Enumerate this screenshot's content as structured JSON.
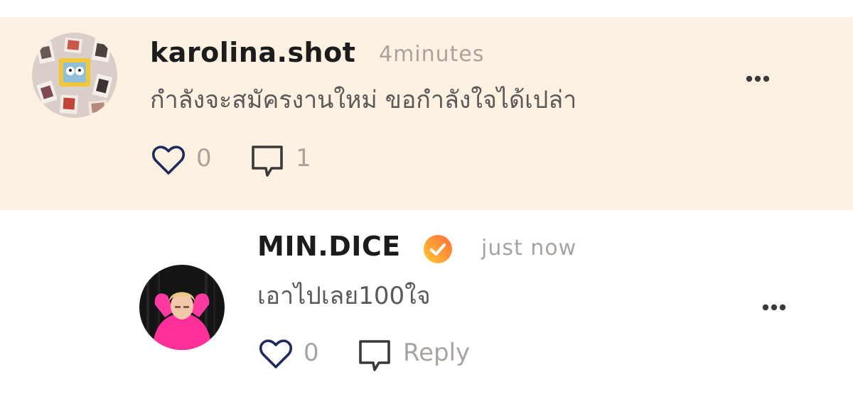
{
  "comment": {
    "username": "karolina.shot",
    "timestamp": "4minutes",
    "text": "กำลังจะสมัครงานใหม่ ขอกำลังใจได้เปล่า",
    "like_count": "0",
    "reply_count": "1",
    "avatar_icon": "photo-collage-avatar",
    "highlight_color": "#fdf1e2"
  },
  "reply": {
    "username": "MIN.DICE",
    "verified_icon": "verified-badge-icon",
    "timestamp": "just now",
    "text": "เอาไปเลย100ใจ",
    "like_count": "0",
    "reply_label": "Reply",
    "avatar_icon": "person-pink-hoodie-avatar"
  },
  "colors": {
    "accent_heart": "#1f2a5c",
    "badge_gradient_start": "#ffcc33",
    "badge_gradient_end": "#ff6a3d"
  }
}
